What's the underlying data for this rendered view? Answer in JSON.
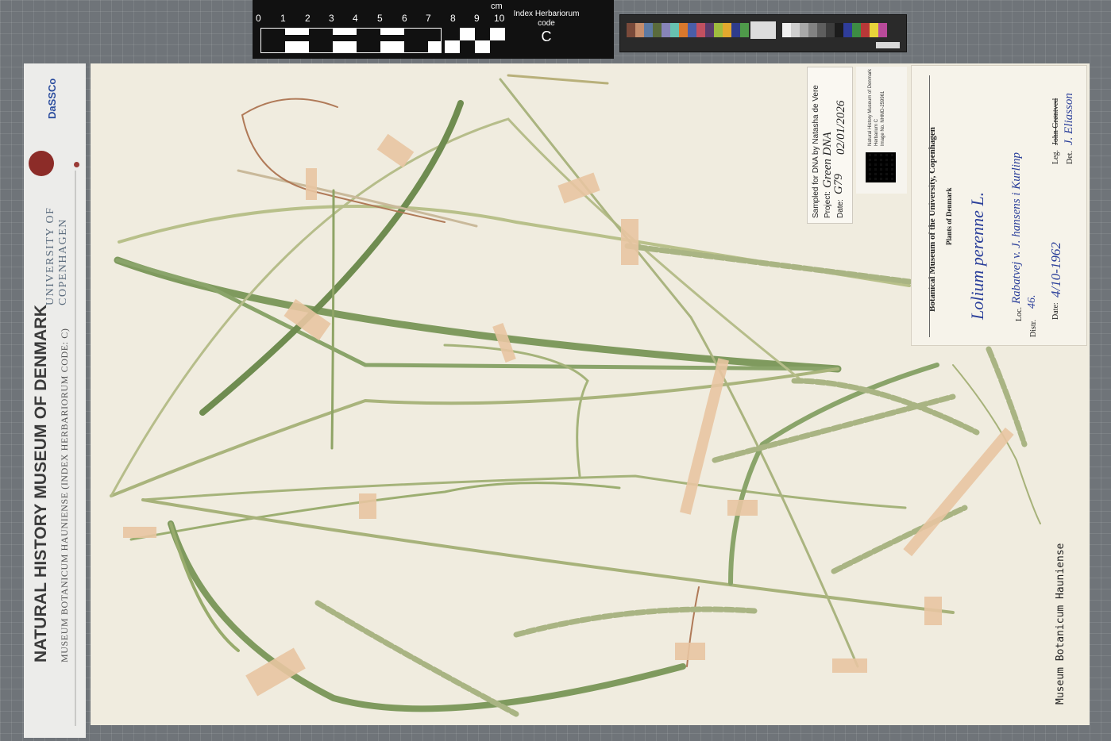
{
  "scale_bar": {
    "unit": "cm",
    "ticks": [
      "0",
      "1",
      "2",
      "3",
      "4",
      "5",
      "6",
      "7",
      "8",
      "9",
      "10"
    ],
    "index_herbariorum_label": "Index Herbariorum code",
    "code": "C"
  },
  "colors": {
    "background": "#6f7479",
    "sheet": "#f0ecdf",
    "plant": "#a7b27a",
    "tape": "#e8c6a2",
    "ink": "#2b3f9a"
  },
  "banner": {
    "title": "NATURAL HISTORY MUSEUM OF DENMARK",
    "subtitle": "MUSEUM BOTANICUM HAUNIENSE (INDEX HERBARIORUM CODE: C)",
    "university_line1": "UNIVERSITY OF",
    "university_line2": "COPENHAGEN",
    "dassco": "DaSSCo"
  },
  "dna_label": {
    "line1": "Sampled for DNA by Natasha de Vere",
    "project_label": "Project:",
    "project_value": "Green DNA",
    "project_code": "G79",
    "date_label": "Date:",
    "date_value": "02/01/2026"
  },
  "image_tag": {
    "line1": "Natural History Museum of Denmark",
    "line2": "Herbarium C",
    "line3": "Image No. NHMD-259961"
  },
  "main_label": {
    "institution": "Botanical Museum of the University, Copenhagen",
    "region": "Plants of Denmark",
    "species": "Lolium perenne L.",
    "loc_label": "Loc.",
    "loc_value": "Rabatvej v. J. hansens i Kurlinp",
    "distr_label": "Distr.",
    "distr_value": "46.",
    "date_label": "Date:",
    "date_value": "4/10-1962",
    "leg_label": "Leg.",
    "leg_value": "John Grøntved",
    "det_label": "Det.",
    "det_value": "J. Eliasson"
  },
  "footer": {
    "stamp": "Museum Botanicum Hauniense"
  }
}
